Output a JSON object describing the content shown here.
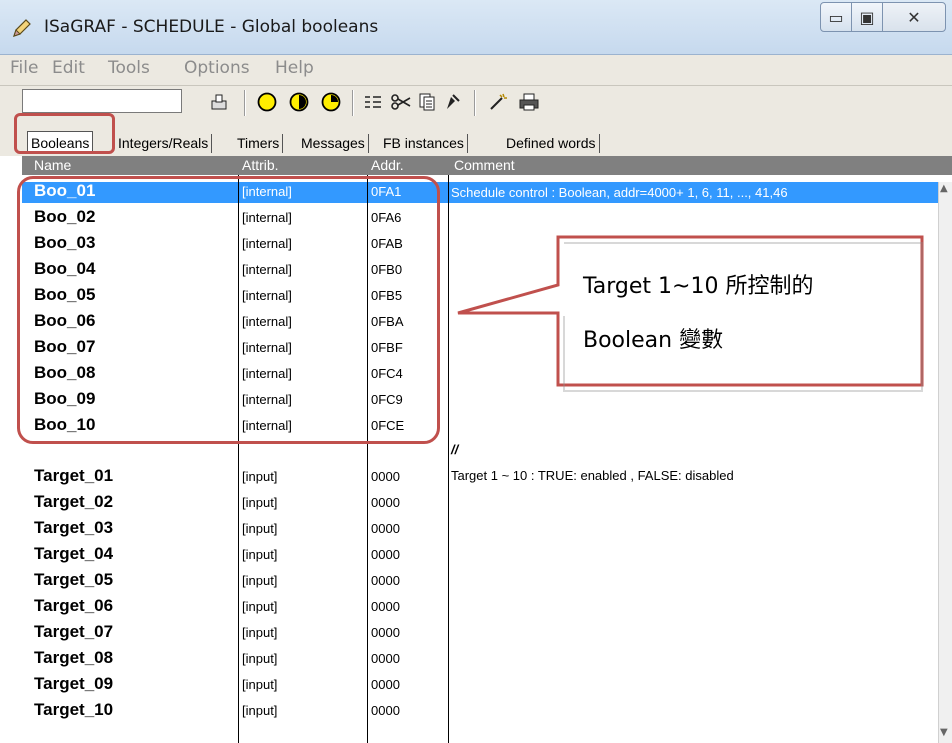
{
  "window": {
    "title": "ISaGRAF - SCHEDULE - Global booleans",
    "controls": {
      "minimize": "▭",
      "maximize": "▣",
      "close": "✕"
    }
  },
  "menu": [
    "File",
    "Edit",
    "Tools",
    "Options",
    "Help"
  ],
  "toolbar": {
    "input_value": "",
    "icons": [
      "stamp-icon",
      "circle-empty-icon",
      "circle-half-icon",
      "circle-clock-icon",
      "indent-icon",
      "cut-icon",
      "copy-icon",
      "edit-icon",
      "wand-icon",
      "print-icon"
    ]
  },
  "tabs": [
    "Booleans",
    "Integers/Reals",
    "Timers",
    "Messages",
    "FB instances",
    "Defined words"
  ],
  "columns": {
    "name": "Name",
    "attrib": "Attrib.",
    "addr": "Addr.",
    "comment": "Comment"
  },
  "internal_rows": [
    {
      "name": "Boo_01",
      "attrib": "[internal]",
      "addr": "0FA1"
    },
    {
      "name": "Boo_02",
      "attrib": "[internal]",
      "addr": "0FA6"
    },
    {
      "name": "Boo_03",
      "attrib": "[internal]",
      "addr": "0FAB"
    },
    {
      "name": "Boo_04",
      "attrib": "[internal]",
      "addr": "0FB0"
    },
    {
      "name": "Boo_05",
      "attrib": "[internal]",
      "addr": "0FB5"
    },
    {
      "name": "Boo_06",
      "attrib": "[internal]",
      "addr": "0FBA"
    },
    {
      "name": "Boo_07",
      "attrib": "[internal]",
      "addr": "0FBF"
    },
    {
      "name": "Boo_08",
      "attrib": "[internal]",
      "addr": "0FC4"
    },
    {
      "name": "Boo_09",
      "attrib": "[internal]",
      "addr": "0FC9"
    },
    {
      "name": "Boo_10",
      "attrib": "[internal]",
      "addr": "0FCE"
    }
  ],
  "input_rows": [
    {
      "name": "Target_01",
      "attrib": "[input]",
      "addr": "0000"
    },
    {
      "name": "Target_02",
      "attrib": "[input]",
      "addr": "0000"
    },
    {
      "name": "Target_03",
      "attrib": "[input]",
      "addr": "0000"
    },
    {
      "name": "Target_04",
      "attrib": "[input]",
      "addr": "0000"
    },
    {
      "name": "Target_05",
      "attrib": "[input]",
      "addr": "0000"
    },
    {
      "name": "Target_06",
      "attrib": "[input]",
      "addr": "0000"
    },
    {
      "name": "Target_07",
      "attrib": "[input]",
      "addr": "0000"
    },
    {
      "name": "Target_08",
      "attrib": "[input]",
      "addr": "0000"
    },
    {
      "name": "Target_09",
      "attrib": "[input]",
      "addr": "0000"
    },
    {
      "name": "Target_10",
      "attrib": "[input]",
      "addr": "0000"
    }
  ],
  "comments": {
    "selected": "Schedule control : Boolean, addr=4000+ 1, 6, 11, ..., 41,46",
    "separator": "//",
    "targets": "Target 1 ~ 10 : TRUE: enabled , FALSE: disabled"
  },
  "callout": {
    "line1": "Target 1~10  所控制的",
    "line2": "Boolean  變數"
  },
  "colors": {
    "selection": "#3399ff",
    "annotation": "#c0504d",
    "header": "#808080"
  }
}
